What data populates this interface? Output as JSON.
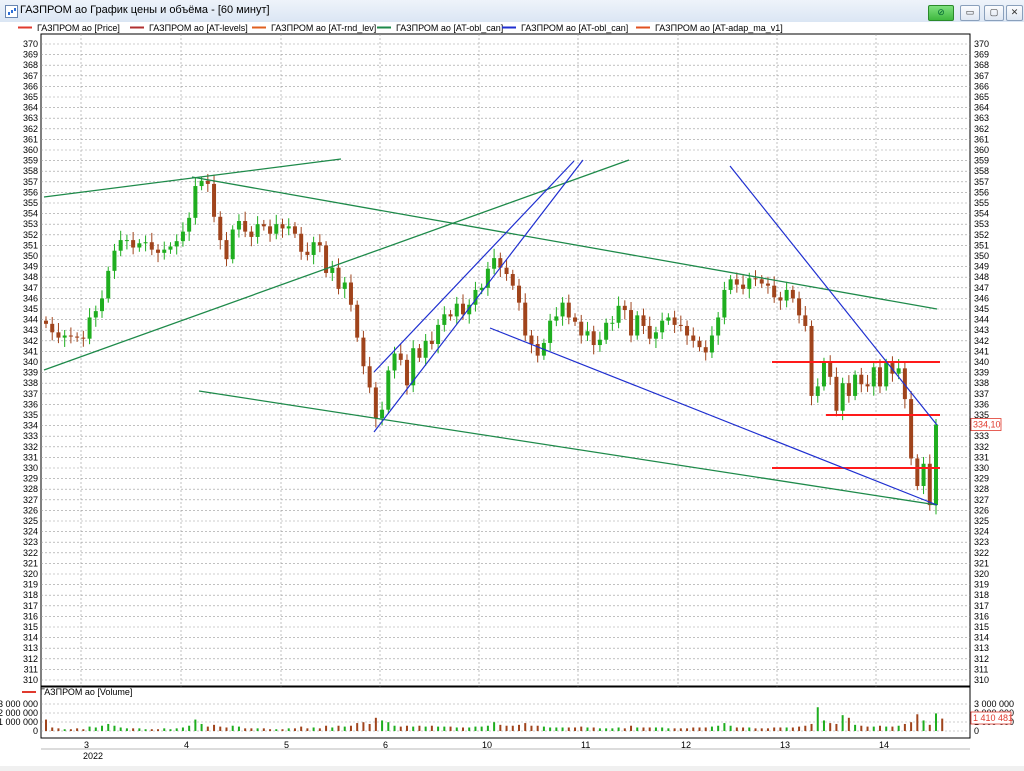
{
  "window": {
    "title": "ГАЗПРОМ ао График цены и объёма - [60 минут]",
    "buttons": {
      "link": "⊘",
      "minimize": "▭",
      "maximize": "▢",
      "close": "✕"
    }
  },
  "legend": [
    {
      "label": "ГАЗПРОМ ао [Price]",
      "color": "#e03a2e"
    },
    {
      "label": "ГАЗПРОМ ао [AT-levels]",
      "color": "#b03030"
    },
    {
      "label": "ГАЗПРОМ ао [AT-rnd_lev]",
      "color": "#e06020"
    },
    {
      "label": "ГАЗПРОМ ао [AT-obl_can]",
      "color": "#1e8a4a"
    },
    {
      "label": "ГАЗПРОМ ао [AT-obl_can]",
      "color": "#1f2fd0"
    },
    {
      "label": "ГАЗПРОМ ао [AT-adap_ma_v1]",
      "color": "#e05020"
    }
  ],
  "volume_legend": {
    "label": "ГАЗПРОМ ао [Volume]",
    "color": "#e03a2e"
  },
  "colors": {
    "up": "#1fae1f",
    "down": "#a0441c",
    "level": "#ff1a1a",
    "channel_green": "#1e8a4a",
    "channel_blue": "#1f2fd0",
    "grid": "#9a9a9a"
  },
  "price_axis": {
    "min": 310,
    "max": 370,
    "step": 1
  },
  "volume_axis": {
    "ticks": [
      "3 000 000",
      "2 000 000",
      "1 000 000",
      "0"
    ]
  },
  "x_axis": {
    "day_labels": [
      "3",
      "4",
      "5",
      "6",
      "10",
      "11",
      "12",
      "13",
      "14"
    ],
    "year_label": "2022"
  },
  "last_price_label": "334,10",
  "last_volume_label": "1 410 481",
  "chart_data": {
    "type": "candlestick",
    "price_levels": [
      340,
      335,
      330
    ],
    "closes": [
      343.6,
      342.8,
      342.3,
      342.5,
      342.4,
      342.3,
      342.2,
      344.2,
      344.8,
      346,
      348.6,
      350.5,
      351.5,
      351.5,
      350.8,
      351.2,
      351.3,
      350.6,
      350.3,
      350.6,
      350.9,
      351.4,
      352.3,
      353.6,
      356.6,
      357.1,
      356.8,
      353.7,
      351.5,
      349.7,
      352.5,
      353.3,
      352.3,
      351.8,
      353,
      352.8,
      352.1,
      353,
      352.6,
      352.8,
      352.1,
      350.4,
      350.1,
      351.3,
      351,
      348.4,
      348.9,
      346.9,
      347.5,
      345.4,
      342.3,
      339.6,
      337.6,
      334.7,
      335.5,
      339.2,
      340.8,
      340.2,
      337.8,
      341.3,
      340.4,
      342,
      341.7,
      343.5,
      344.5,
      344.3,
      345.5,
      344.5,
      345.4,
      346.8,
      347,
      348.8,
      349.8,
      348.9,
      348.3,
      347.2,
      345.6,
      342.5,
      341.7,
      340.6,
      341.8,
      343.9,
      344.3,
      345.6,
      344.2,
      343.8,
      342.5,
      342.9,
      341.6,
      342.1,
      343.7,
      343.7,
      345.3,
      344.9,
      342.5,
      344.4,
      343.4,
      342.2,
      342.8,
      343.9,
      344.2,
      343.5,
      343.4,
      342.5,
      342,
      341.4,
      340.9,
      342.5,
      344.2,
      346.8,
      347.8,
      347.3,
      346.9,
      347.9,
      347.8,
      347.4,
      347.2,
      346.1,
      345.8,
      346.8,
      346,
      344.4,
      343.4,
      336.8,
      337.7,
      340,
      338.6,
      335.4,
      338,
      336.8,
      338.8,
      337.9,
      337.7,
      339.5,
      337.7,
      339.9,
      338.9,
      339.4,
      336.5,
      330.9,
      328.3,
      330.4,
      326.5,
      334.1
    ],
    "volume_millions": [
      1.3,
      0.4,
      0.3,
      0.2,
      0.2,
      0.3,
      0.2,
      0.5,
      0.4,
      0.6,
      0.8,
      0.6,
      0.4,
      0.3,
      0.3,
      0.3,
      0.2,
      0.2,
      0.2,
      0.3,
      0.2,
      0.3,
      0.4,
      0.6,
      1.3,
      0.8,
      0.5,
      0.7,
      0.5,
      0.4,
      0.6,
      0.5,
      0.3,
      0.3,
      0.3,
      0.3,
      0.2,
      0.2,
      0.2,
      0.3,
      0.3,
      0.5,
      0.3,
      0.4,
      0.3,
      0.6,
      0.4,
      0.6,
      0.5,
      0.6,
      0.9,
      1.0,
      0.8,
      1.5,
      1.2,
      1.0,
      0.6,
      0.5,
      0.6,
      0.5,
      0.6,
      0.5,
      0.6,
      0.5,
      0.5,
      0.5,
      0.4,
      0.4,
      0.4,
      0.5,
      0.5,
      0.6,
      1.0,
      0.7,
      0.6,
      0.6,
      0.7,
      0.9,
      0.6,
      0.6,
      0.5,
      0.4,
      0.4,
      0.4,
      0.4,
      0.4,
      0.5,
      0.4,
      0.4,
      0.3,
      0.3,
      0.3,
      0.4,
      0.3,
      0.6,
      0.4,
      0.4,
      0.4,
      0.4,
      0.4,
      0.3,
      0.3,
      0.3,
      0.3,
      0.4,
      0.4,
      0.4,
      0.5,
      0.6,
      0.9,
      0.6,
      0.4,
      0.4,
      0.4,
      0.3,
      0.3,
      0.3,
      0.4,
      0.4,
      0.4,
      0.4,
      0.5,
      0.6,
      0.8,
      2.7,
      1.2,
      0.9,
      0.8,
      1.8,
      1.5,
      0.7,
      0.6,
      0.5,
      0.5,
      0.6,
      0.5,
      0.5,
      0.6,
      0.8,
      1.0,
      1.9,
      1.2,
      0.7,
      2.0,
      1.41
    ]
  }
}
